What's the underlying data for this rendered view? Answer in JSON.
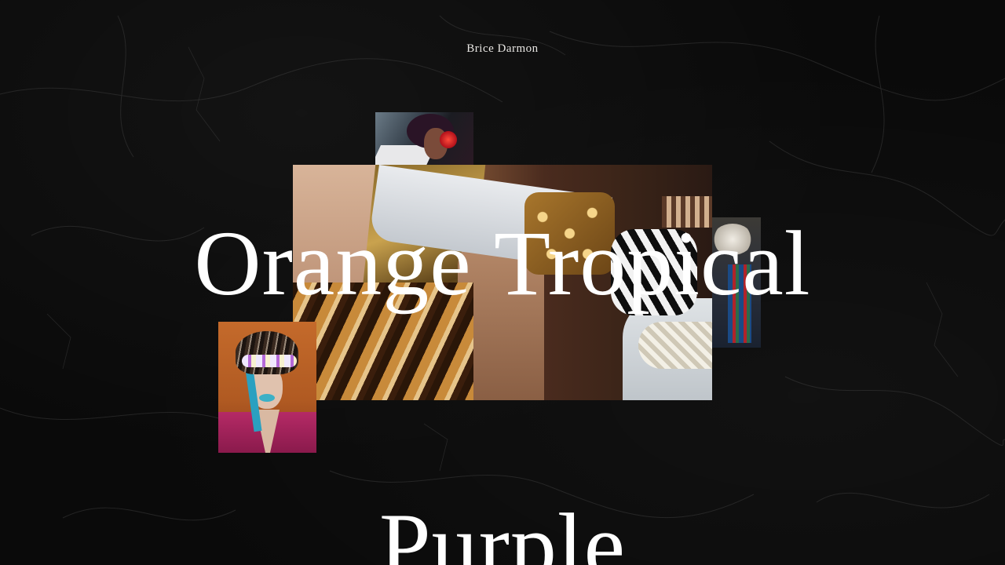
{
  "site": {
    "title": "Brice Darmon"
  },
  "slides": [
    {
      "title": "Orange Tropical"
    },
    {
      "title": "Purple"
    }
  ],
  "colors": {
    "background": "#0a0a0a",
    "text": "#ffffff",
    "site_title": "#e8e6e3"
  }
}
